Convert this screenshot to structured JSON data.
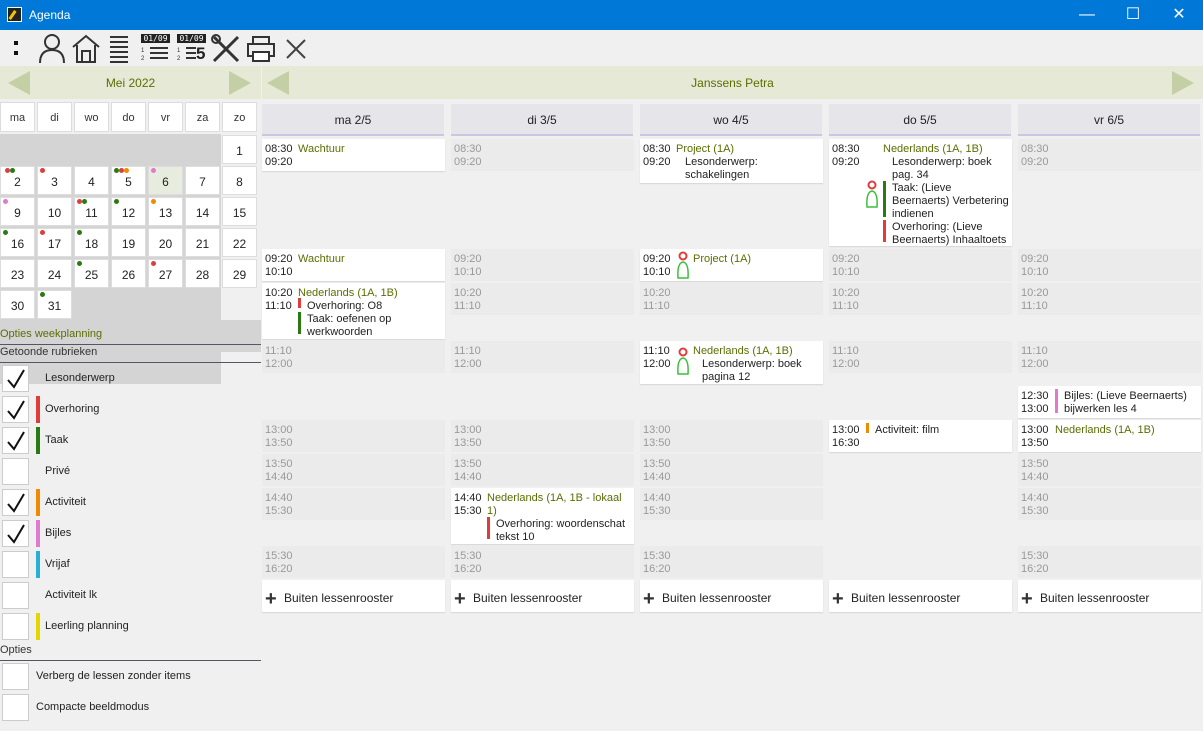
{
  "window": {
    "title": "Agenda",
    "minimize": "—",
    "maximize": "☐",
    "close": "✕"
  },
  "toolbar": {
    "date1": "01/09",
    "date2": "01/09",
    "date2_num": "5"
  },
  "calendar": {
    "month_label": "Mei 2022",
    "weekdays": [
      "ma",
      "di",
      "wo",
      "do",
      "vr",
      "za",
      "zo"
    ],
    "days": [
      "1",
      "2",
      "3",
      "4",
      "5",
      "6",
      "7",
      "8",
      "9",
      "10",
      "11",
      "12",
      "13",
      "14",
      "15",
      "16",
      "17",
      "18",
      "19",
      "20",
      "21",
      "22",
      "23",
      "24",
      "25",
      "26",
      "27",
      "28",
      "29",
      "30",
      "31"
    ]
  },
  "sections": {
    "options_weekplan": "Opties weekplanning",
    "shown_categories": "Getoonde rubrieken",
    "options": "Opties"
  },
  "categories": [
    {
      "label": "Lesonderwerp",
      "checked": true,
      "color": ""
    },
    {
      "label": "Overhoring",
      "checked": true,
      "color": "#e03c3c"
    },
    {
      "label": "Taak",
      "checked": true,
      "color": "#2a7a12"
    },
    {
      "label": "Privé",
      "checked": false,
      "color": ""
    },
    {
      "label": "Activiteit",
      "checked": true,
      "color": "#f08a00"
    },
    {
      "label": "Bijles",
      "checked": true,
      "color": "#e07ad0"
    },
    {
      "label": "Vrijaf",
      "checked": false,
      "color": "#26b0d8"
    },
    {
      "label": "Activiteit lk",
      "checked": false,
      "color": ""
    },
    {
      "label": "Leerling planning",
      "checked": false,
      "color": "#e6d600"
    }
  ],
  "options": [
    {
      "label": "Verberg de lessen zonder items"
    },
    {
      "label": "Compacte beeldmodus"
    }
  ],
  "week": {
    "person": "Janssens Petra",
    "days": [
      "ma 2/5",
      "di 3/5",
      "wo 4/5",
      "do 5/5",
      "vr 6/5"
    ],
    "outside_label": "Buiten lessenrooster"
  },
  "slots": {
    "s0830": "08:30",
    "s0920": "09:20",
    "s1010": "10:10",
    "s1020": "10:20",
    "s1110": "11:10",
    "s1200": "12:00",
    "s1300": "13:00",
    "s1350": "13:50",
    "s1440": "14:40",
    "s1530": "15:30",
    "s1620": "16:20",
    "s1230": "12:30",
    "s1630": "16:30"
  },
  "entries": {
    "mon_wacht": "Wachtuur",
    "mon_ned": "Nederlands (1A, 1B)",
    "mon_ned_i1": "Overhoring: O8",
    "mon_ned_i2a": "Taak: oefenen op",
    "mon_ned_i2b": "werkwoorden",
    "tue_ned_a": "Nederlands (1A, 1B - lokaal",
    "tue_ned_b": "1)",
    "tue_ned_i1a": "Overhoring: woordenschat",
    "tue_ned_i1b": "tekst 10",
    "wed_proj": "Project (1A)",
    "wed_proj_i1a": "Lesonderwerp:",
    "wed_proj_i1b": "schakelingen",
    "wed_ned": "Nederlands (1A, 1B)",
    "wed_ned_i1a": "Lesonderwerp: boek",
    "wed_ned_i1b": "pagina 12",
    "thu_ned": "Nederlands (1A, 1B)",
    "thu_i1a": "Lesonderwerp: boek",
    "thu_i1b": "pag. 34",
    "thu_i2a": "Taak: (Lieve",
    "thu_i2b": "Beernaerts) Verbetering",
    "thu_i2c": "indienen",
    "thu_i3a": "Overhoring: (Lieve",
    "thu_i3b": "Beernaerts) Inhaaltoets",
    "thu_act": "Activiteit: film",
    "fri_bij_a": "Bijles: (Lieve Beernaerts)",
    "fri_bij_b": "bijwerken les 4",
    "fri_ned": "Nederlands (1A, 1B)"
  },
  "colors": {
    "accent": "#5a6e00",
    "titlebar": "#0078d7",
    "overhoring": "#e03c3c",
    "taak": "#2a7a12",
    "activiteit": "#f08a00",
    "bijles": "#e07ad0"
  }
}
